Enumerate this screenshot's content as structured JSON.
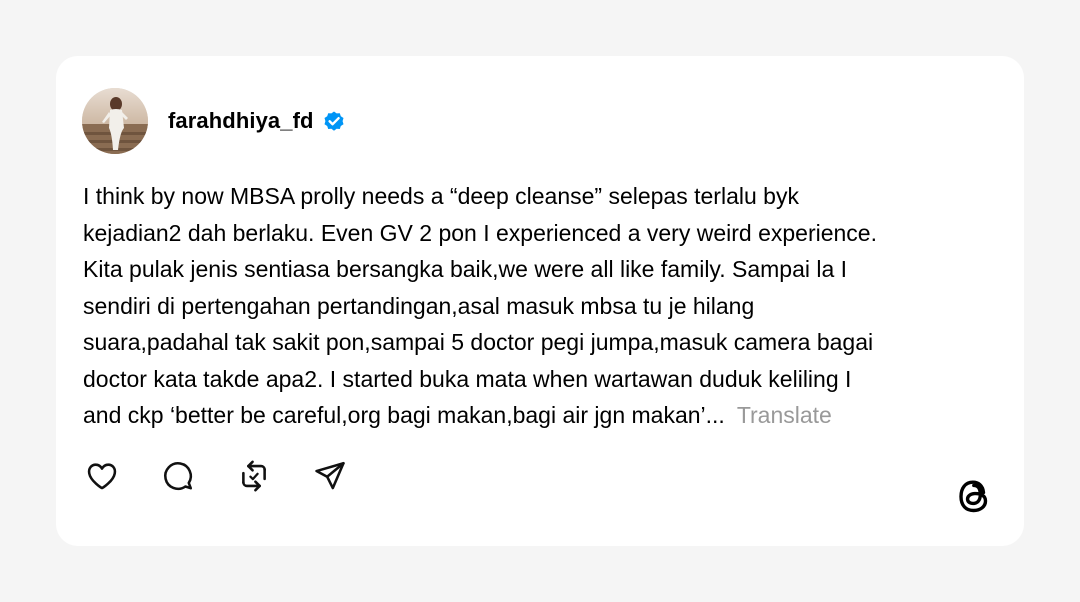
{
  "post": {
    "username": "farahdhiya_fd",
    "verified_icon": "verified-badge-icon",
    "text_lines": [
      "I think by now MBSA prolly needs a “deep cleanse” selepas terlalu byk",
      "kejadian2 dah berlaku. Even GV 2 pon I experienced a very weird experience.",
      "Kita pulak jenis sentiasa bersangka baik,we were all like family. Sampai la I",
      "sendiri di pertengahan pertandingan,asal masuk mbsa tu je hilang",
      "suara,padahal tak sakit pon,sampai 5 doctor pegi jumpa,masuk camera bagai",
      "doctor kata takde apa2. I started buka mata when wartawan duduk keliling I",
      "and ckp ‘better be careful,org bagi makan,bagi air jgn makan’..."
    ],
    "translate_label": "Translate"
  },
  "actions": {
    "like_icon": "heart-icon",
    "comment_icon": "comment-icon",
    "repost_icon": "repost-icon",
    "share_icon": "send-icon"
  },
  "brand": {
    "logo_icon": "threads-logo-icon",
    "verified_color": "#0095f6",
    "background": "#f5f5f5",
    "card": "#ffffff"
  }
}
